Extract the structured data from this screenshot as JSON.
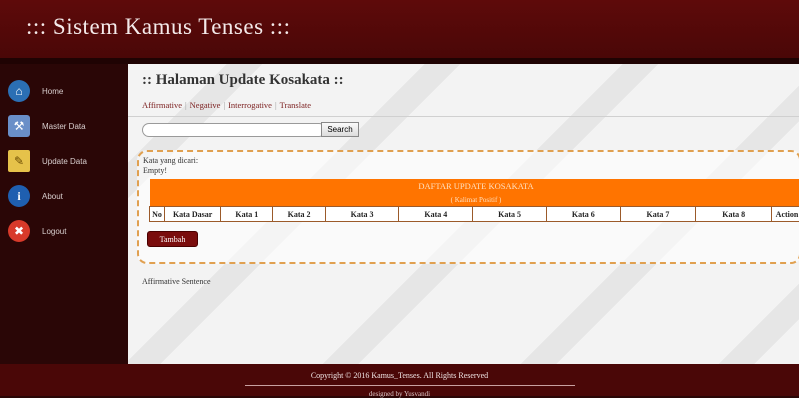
{
  "header": {
    "title": "::: Sistem Kamus Tenses :::"
  },
  "sidebar": {
    "items": [
      {
        "label": "Home",
        "icon": "home-icon",
        "color": "#2b6fb4"
      },
      {
        "label": "Master Data",
        "icon": "tools-icon",
        "color": "#6a8fc8"
      },
      {
        "label": "Update Data",
        "icon": "folder-icon",
        "color": "#e6c24a"
      },
      {
        "label": "About",
        "icon": "info-icon",
        "color": "#1f5fb0"
      },
      {
        "label": "Logout",
        "icon": "logout-icon",
        "color": "#d83a2a"
      }
    ]
  },
  "main": {
    "heading": ":: Halaman Update Kosakata ::",
    "tabs": [
      {
        "label": "Affirmative"
      },
      {
        "label": "Negative"
      },
      {
        "label": "Interrogative"
      },
      {
        "label": "Translate"
      }
    ],
    "search": {
      "value": "",
      "placeholder": "",
      "button_label": "Search"
    },
    "result": {
      "kata_label": "Kata yang dicari:",
      "empty_text": "Empty!",
      "table_title": "DAFTAR UPDATE KOSAKATA",
      "table_subtitle": "( Kalimat Positif )",
      "columns": [
        "No",
        "Kata Dasar",
        "Kata 1",
        "Kata 2",
        "Kata 3",
        "Kata 4",
        "Kata 5",
        "Kata 6",
        "Kata 7",
        "Kata 8",
        "Action"
      ]
    },
    "add_button_label": "Tambah",
    "sentence_label": "Affirmative Sentence"
  },
  "footer": {
    "copyright": "Copyright © 2016 Kamus_Tenses. All Rights Reserved",
    "designed_by": "designed by Yusvandi"
  },
  "colors": {
    "header_bg": "#5e0a0a",
    "banner_orange": "#ff7400",
    "accent_maroon": "#7a0d0d",
    "dashed_border": "#e0a050"
  }
}
